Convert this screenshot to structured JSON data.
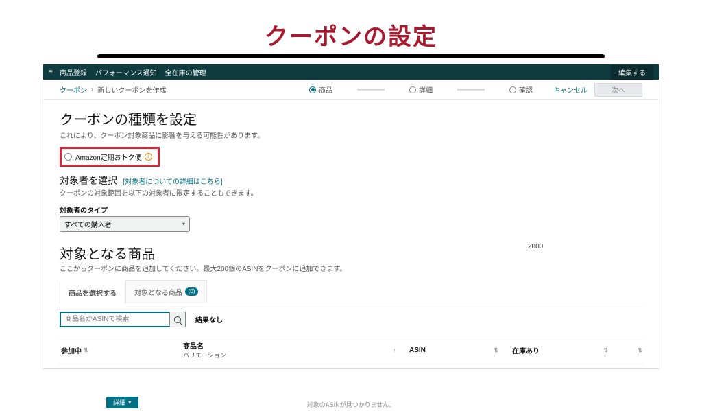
{
  "slide": {
    "title": "クーポンの設定"
  },
  "topbar": {
    "items": [
      "商品登録",
      "パフォーマンス通知",
      "全在庫の管理"
    ],
    "edit": "編集する"
  },
  "breadcrumb": {
    "root": "クーポン",
    "sep": "›",
    "current": "新しいクーポンを作成"
  },
  "steps": {
    "s1": "商品",
    "s2": "詳細",
    "s3": "確認"
  },
  "actions": {
    "cancel": "キャンセル",
    "next": "次へ"
  },
  "type_section": {
    "heading": "クーポンの種類を設定",
    "desc": "これにより、クーポン対象商品に影響を与える可能性があります。",
    "option": "Amazon定期おトク便"
  },
  "audience": {
    "heading": "対象者を選択",
    "link": "[対象者についての詳細はこちら]",
    "desc": "クーポンの対象範囲を以下の対象者に限定することもできます。",
    "label": "対象者のタイプ",
    "selected": "すべての購入者"
  },
  "floating": {
    "num": "2000"
  },
  "products": {
    "heading": "対象となる商品",
    "desc": "ここからクーポンに商品を追加してください。最大200個のASINをクーポンに追加できます。",
    "tab_select": "商品を選択する",
    "tab_target": "対象となる商品",
    "tab_target_count": "(0)",
    "search_placeholder": "商品名かASINで検索",
    "no_result": "結果なし",
    "cols": {
      "c1": "参加中",
      "c2": "商品名",
      "c2sub": "バリエーション",
      "c3": "ASIN",
      "c4": "在庫あり"
    }
  },
  "footer": {
    "chip": "詳細",
    "note": "対象のASINが見つかりません。"
  }
}
